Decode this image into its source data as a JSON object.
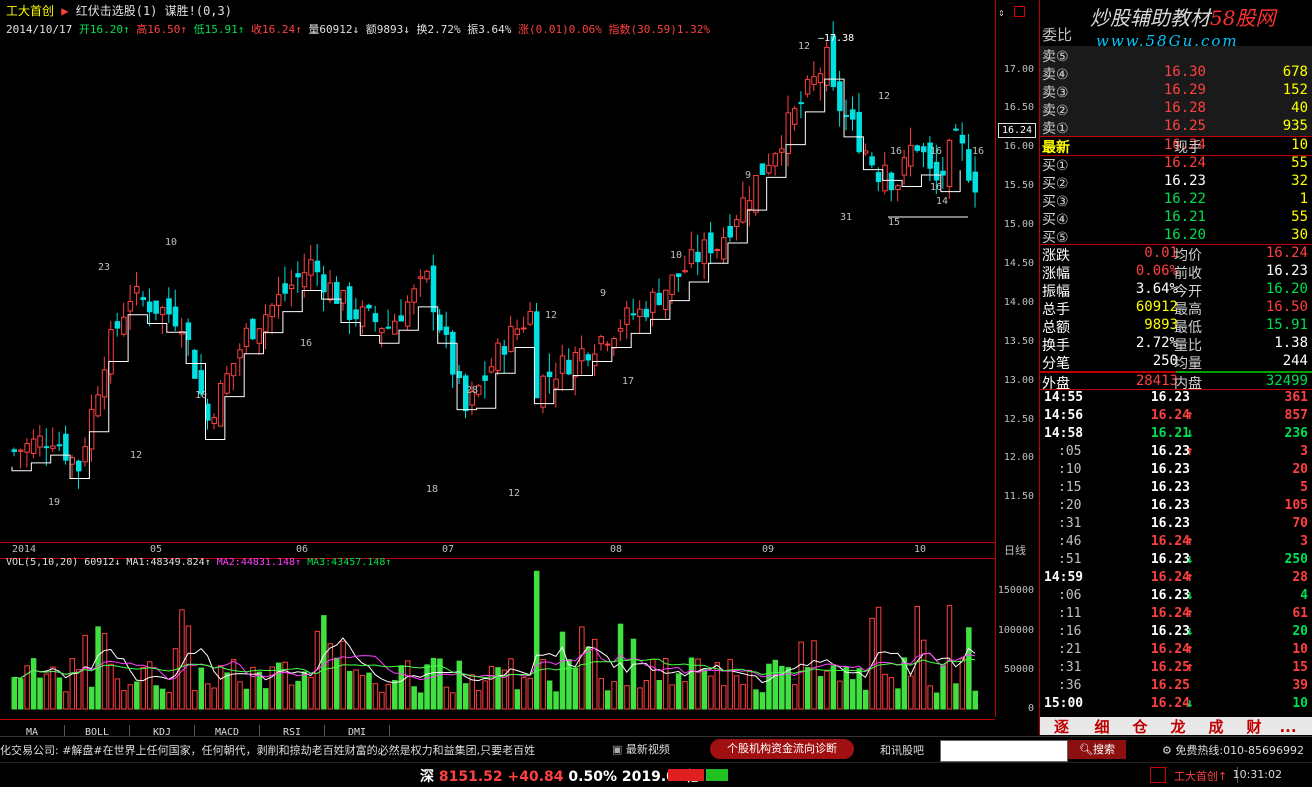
{
  "header": {
    "stock_name": "工大首创",
    "indicator": "红伏击选股(1) 谋胜!(0,3)",
    "date": "2014/10/17",
    "open": "开16.20↑",
    "high": "高16.50↑",
    "low": "低15.91↑",
    "close": "收16.24↑",
    "volume": "量60912↓",
    "amount": "额9893↓",
    "turnover": "换2.72%",
    "amplitude": "振3.64%",
    "change": "涨(0.01)0.06%",
    "index": "指数(30.59)1.32%"
  },
  "price_axis": {
    "labels": [
      "17.00",
      "16.50",
      "16.00",
      "15.50",
      "15.00",
      "14.50",
      "14.00",
      "13.50",
      "13.00",
      "12.50",
      "12.00",
      "11.50"
    ],
    "current_tag": "16.24"
  },
  "time_axis": {
    "labels": [
      "2014",
      "05",
      "06",
      "07",
      "08",
      "09",
      "10"
    ],
    "period": "日线"
  },
  "chart_annotations": {
    "peak": "17.38",
    "numbers": [
      "19",
      "23",
      "10",
      "10",
      "12",
      "16",
      "28",
      "12",
      "9",
      "12",
      "17",
      "10",
      "9",
      "12",
      "16",
      "16",
      "16",
      "31",
      "14",
      "15",
      "16",
      "18",
      "12"
    ]
  },
  "volume_panel": {
    "header": "VOL(5,10,20) 60912↓MA1:48349.824↑MA2:44831.148↑MA3:43457.148↑",
    "vol_label": "VOL(5,10,20) 60912↓",
    "ma1_label": "MA1:48349.824↑",
    "ma2_label": "MA2:44831.148↑",
    "ma3_label": "MA3:43457.148↑",
    "axis_labels": [
      "150000",
      "100000",
      "50000",
      "0"
    ]
  },
  "bottom_tabs": [
    "MA",
    "BOLL",
    "KDJ",
    "MACD",
    "RSI",
    "DMI"
  ],
  "right_panel": {
    "logo_text": "炒股辅助教材",
    "logo_red": "58股网",
    "logo_url": "www.58Gu.com",
    "ratio_label": "委比",
    "sell_orders": [
      {
        "label": "卖⑤",
        "price": "",
        "volume": ""
      },
      {
        "label": "卖④",
        "price": "16.30",
        "volume": "678"
      },
      {
        "label": "卖③",
        "price": "16.29",
        "volume": "152"
      },
      {
        "label": "卖②",
        "price": "16.28",
        "volume": "40"
      },
      {
        "label": "卖①",
        "price": "16.25",
        "volume": "935"
      }
    ],
    "latest": {
      "label": "最新",
      "price": "16.24",
      "cur_label": "现手",
      "cur_vol": "10"
    },
    "buy_orders": [
      {
        "label": "买①",
        "price": "16.24",
        "volume": "55"
      },
      {
        "label": "买②",
        "price": "16.23",
        "volume": "32"
      },
      {
        "label": "买③",
        "price": "16.22",
        "volume": "1"
      },
      {
        "label": "买④",
        "price": "16.21",
        "volume": "55"
      },
      {
        "label": "买⑤",
        "price": "16.20",
        "volume": "30"
      }
    ],
    "stats": [
      {
        "l1": "涨跌",
        "v1": "0.01",
        "l2": "均价",
        "v2": "16.24"
      },
      {
        "l1": "涨幅",
        "v1": "0.06%",
        "l2": "前收",
        "v2": "16.23"
      },
      {
        "l1": "振幅",
        "v1": "3.64%",
        "l2": "今开",
        "v2": "16.20"
      },
      {
        "l1": "总手",
        "v1": "60912",
        "l2": "最高",
        "v2": "16.50"
      },
      {
        "l1": "总额",
        "v1": "9893",
        "l2": "最低",
        "v2": "15.91"
      },
      {
        "l1": "换手",
        "v1": "2.72%",
        "l2": "量比",
        "v2": "1.38"
      },
      {
        "l1": "分笔",
        "v1": "250",
        "l2": "均量",
        "v2": "244"
      },
      {
        "l1": "外盘",
        "v1": "28413",
        "l2": "内盘",
        "v2": "32499"
      }
    ],
    "ticks": [
      {
        "time": "14:55",
        "price": "16.23",
        "arrow": "",
        "vol": "361"
      },
      {
        "time": "14:56",
        "price": "16.24",
        "arrow": "↑",
        "vol": "857"
      },
      {
        "time": "14:58",
        "price": "16.21",
        "arrow": "↓",
        "vol": "236"
      },
      {
        "time": ":05",
        "price": "16.23",
        "arrow": "↑",
        "vol": "3"
      },
      {
        "time": ":10",
        "price": "16.23",
        "arrow": "",
        "vol": "20"
      },
      {
        "time": ":15",
        "price": "16.23",
        "arrow": "",
        "vol": "5"
      },
      {
        "time": ":20",
        "price": "16.23",
        "arrow": "",
        "vol": "105"
      },
      {
        "time": ":31",
        "price": "16.23",
        "arrow": "",
        "vol": "70"
      },
      {
        "time": ":46",
        "price": "16.24",
        "arrow": "↑",
        "vol": "3"
      },
      {
        "time": ":51",
        "price": "16.23",
        "arrow": "↓",
        "vol": "250"
      },
      {
        "time": "14:59",
        "price": "16.24",
        "arrow": "↑",
        "vol": "28"
      },
      {
        "time": ":06",
        "price": "16.23",
        "arrow": "↓",
        "vol": "4"
      },
      {
        "time": ":11",
        "price": "16.24",
        "arrow": "↑",
        "vol": "61"
      },
      {
        "time": ":16",
        "price": "16.23",
        "arrow": "↓",
        "vol": "20"
      },
      {
        "time": ":21",
        "price": "16.24",
        "arrow": "↑",
        "vol": "10"
      },
      {
        "time": ":31",
        "price": "16.25",
        "arrow": "↑",
        "vol": "15"
      },
      {
        "time": ":36",
        "price": "16.25",
        "arrow": "",
        "vol": "39"
      },
      {
        "time": "15:00",
        "price": "16.24",
        "arrow": "↓",
        "vol": "10"
      }
    ],
    "tabs": [
      "逐",
      "细",
      "仓",
      "龙",
      "成",
      "财",
      "..."
    ]
  },
  "statusbar": {
    "ticker": "化交易公司:  #解盘#在世界上任何国家，任何朝代，剥削和掠劫老百姓财富的必然是权力和益集团,只要老百姓",
    "video": "最新视频",
    "fund_button": "个股机构资金流向诊断",
    "hexun": "和讯股吧",
    "search_placeholder": "",
    "search_button": "搜索",
    "hotline": "免费热线:010-85696992"
  },
  "bottombar": {
    "index_name": "深",
    "index_value": "8151.52",
    "index_change": "+40.84",
    "index_pct": "0.50%",
    "index_amount": "2019.07亿",
    "stock": "工大首创↑",
    "time": "10:31:02"
  },
  "colors": {
    "up": "#ff4040",
    "down": "#00e0e0",
    "vol_down": "#40e040",
    "border": "#c00000",
    "ma1": "#ffffff",
    "ma2": "#ff40ff",
    "ma3": "#40ff40"
  }
}
